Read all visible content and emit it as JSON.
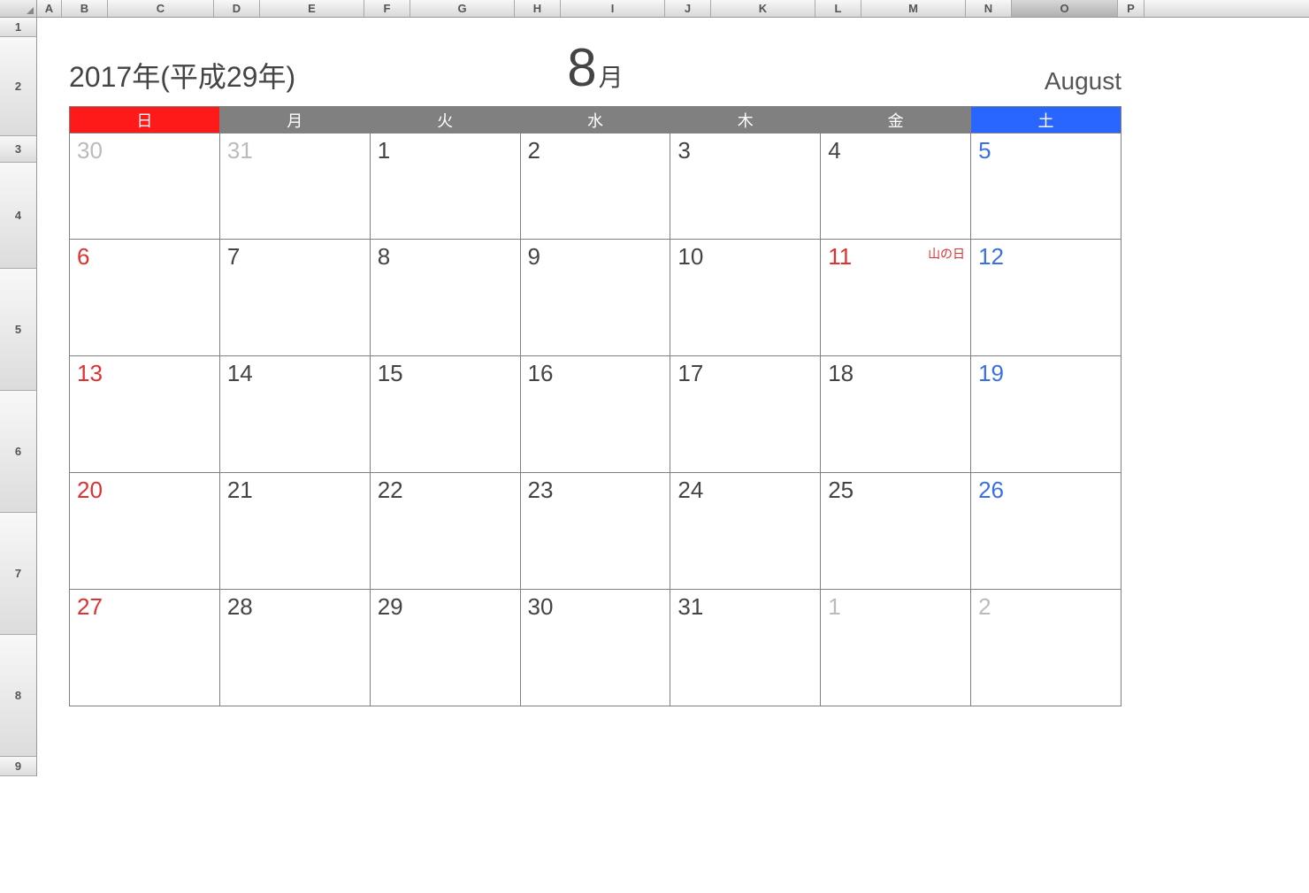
{
  "columns": [
    "A",
    "B",
    "C",
    "D",
    "E",
    "F",
    "G",
    "H",
    "I",
    "J",
    "K",
    "L",
    "M",
    "N",
    "O",
    "P"
  ],
  "selected_column": "O",
  "rows": [
    "1",
    "2",
    "3",
    "4",
    "5",
    "6",
    "7",
    "8",
    "9"
  ],
  "title": {
    "year": "2017年(平成29年)",
    "month_num": "8",
    "month_suffix": "月",
    "month_english": "August"
  },
  "weekdays": [
    "日",
    "月",
    "火",
    "水",
    "木",
    "金",
    "土"
  ],
  "weeks": [
    [
      {
        "num": "30",
        "style": "gray"
      },
      {
        "num": "31",
        "style": "gray"
      },
      {
        "num": "1",
        "style": ""
      },
      {
        "num": "2",
        "style": ""
      },
      {
        "num": "3",
        "style": ""
      },
      {
        "num": "4",
        "style": ""
      },
      {
        "num": "5",
        "style": "blue"
      }
    ],
    [
      {
        "num": "6",
        "style": "red"
      },
      {
        "num": "7",
        "style": ""
      },
      {
        "num": "8",
        "style": ""
      },
      {
        "num": "9",
        "style": ""
      },
      {
        "num": "10",
        "style": ""
      },
      {
        "num": "11",
        "style": "red",
        "holiday": "山の日"
      },
      {
        "num": "12",
        "style": "blue"
      }
    ],
    [
      {
        "num": "13",
        "style": "red"
      },
      {
        "num": "14",
        "style": ""
      },
      {
        "num": "15",
        "style": ""
      },
      {
        "num": "16",
        "style": ""
      },
      {
        "num": "17",
        "style": ""
      },
      {
        "num": "18",
        "style": ""
      },
      {
        "num": "19",
        "style": "blue"
      }
    ],
    [
      {
        "num": "20",
        "style": "red"
      },
      {
        "num": "21",
        "style": ""
      },
      {
        "num": "22",
        "style": ""
      },
      {
        "num": "23",
        "style": ""
      },
      {
        "num": "24",
        "style": ""
      },
      {
        "num": "25",
        "style": ""
      },
      {
        "num": "26",
        "style": "blue"
      }
    ],
    [
      {
        "num": "27",
        "style": "red"
      },
      {
        "num": "28",
        "style": ""
      },
      {
        "num": "29",
        "style": ""
      },
      {
        "num": "30",
        "style": ""
      },
      {
        "num": "31",
        "style": ""
      },
      {
        "num": "1",
        "style": "gray"
      },
      {
        "num": "2",
        "style": "gray"
      }
    ]
  ],
  "colors": {
    "sunday_header": "#ff1a1a",
    "saturday_header": "#2966ff",
    "weekday_header": "#808080",
    "red_text": "#e03030",
    "blue_text": "#3a6fe8",
    "gray_text": "#bbbbbb"
  }
}
